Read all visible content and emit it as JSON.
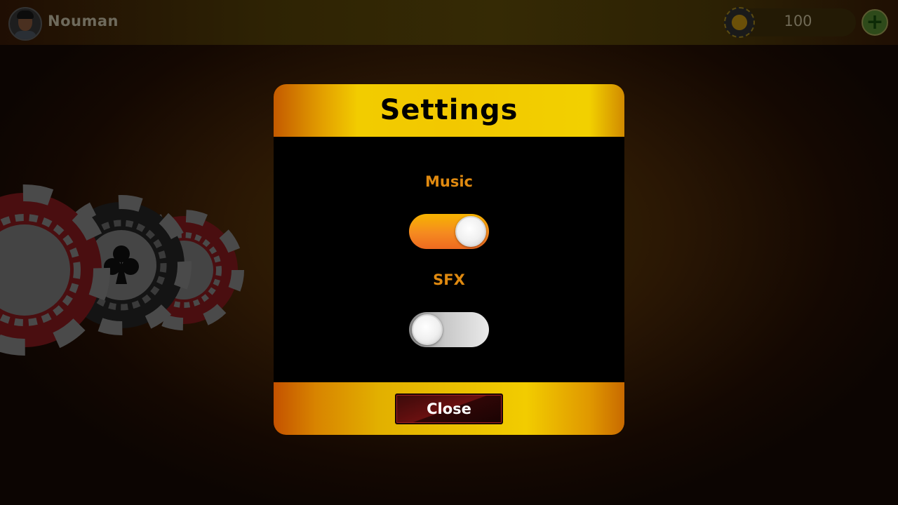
{
  "topbar": {
    "username": "Nouman",
    "coins": "100",
    "add_coins_icon": "plus-icon"
  },
  "dialog": {
    "title": "Settings",
    "music": {
      "label": "Music",
      "enabled": true
    },
    "sfx": {
      "label": "SFX",
      "enabled": false
    },
    "close_label": "Close"
  },
  "colors": {
    "accent": "#f2c800",
    "label": "#e08a10",
    "toggle_on": "#f58a20"
  }
}
